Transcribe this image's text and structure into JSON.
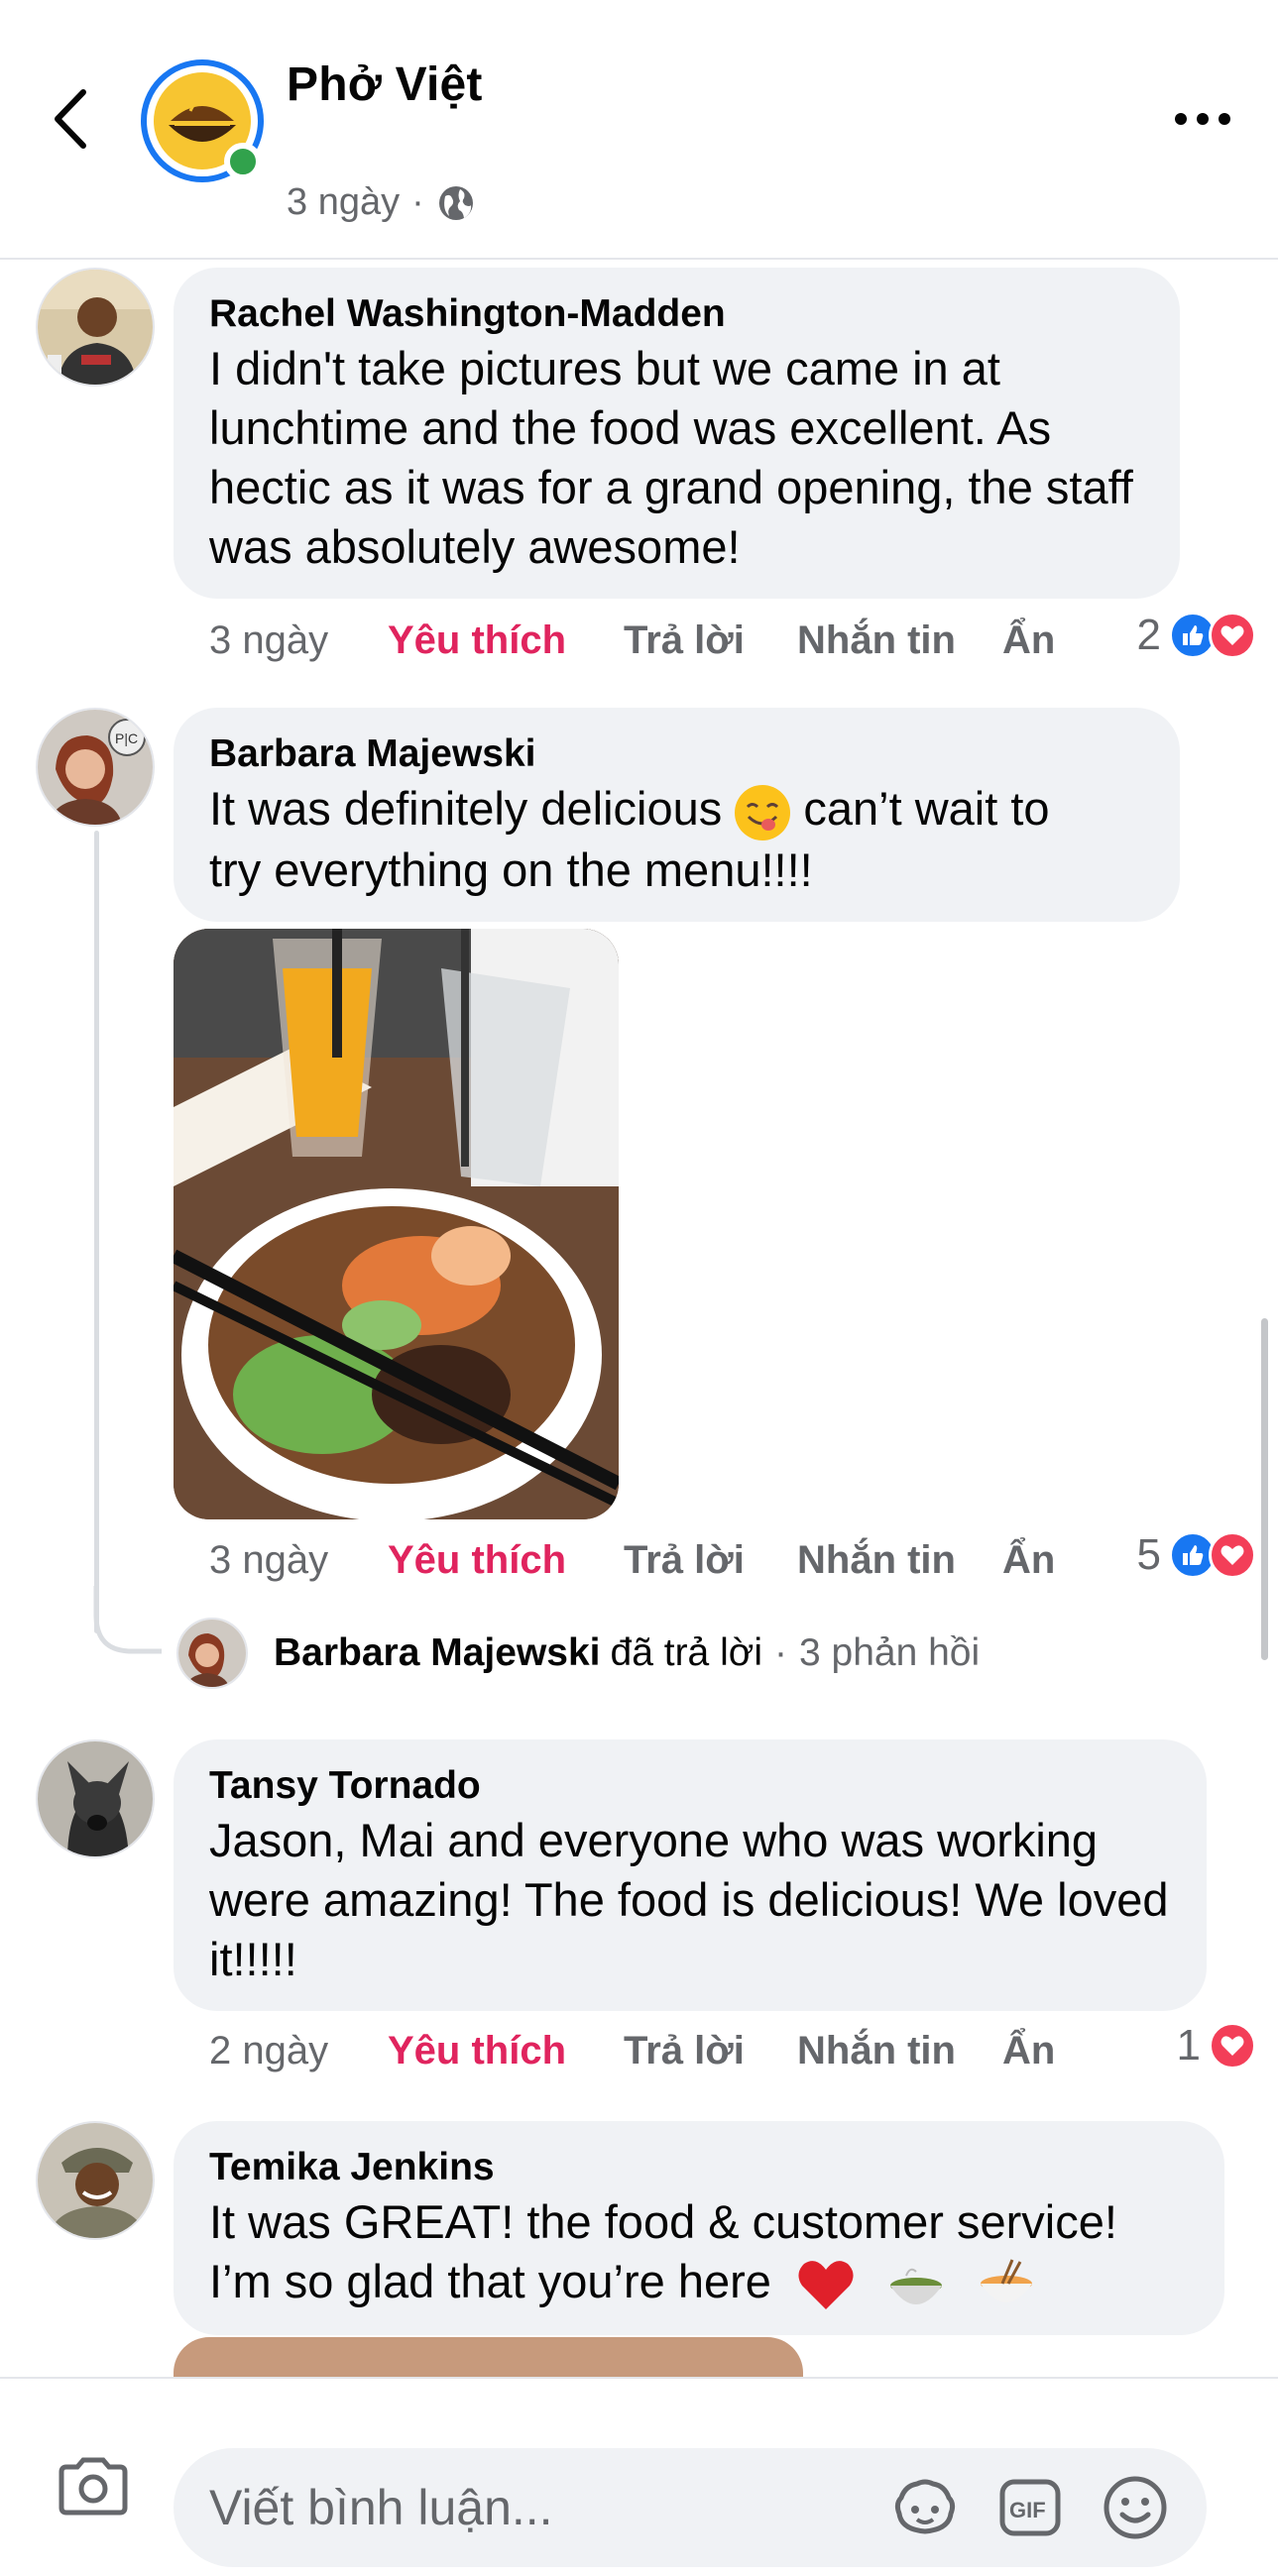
{
  "header": {
    "page_name": "Phở Việt",
    "time": "3 ngày",
    "separator": "·",
    "privacy_icon": "globe-icon"
  },
  "comments": [
    {
      "author": "Rachel Washington-Madden",
      "text": "I didn't take pictures but we came in at lunchtime and the food was excellent.  As hectic as it was for a grand opening, the staff was absolutely awesome!",
      "time": "3 ngày",
      "like": "Yêu thích",
      "reply": "Trả lời",
      "message": "Nhắn tin",
      "hide": "Ẩn",
      "reaction_count": "2",
      "reactions": [
        "like-icon",
        "love-icon"
      ]
    },
    {
      "author": "Barbara Majewski",
      "text_before_emoji": "It was definitely delicious ",
      "emoji": "yum-face-emoji",
      "text_after_emoji": " can’t wait to",
      "text_line2": "try everything on the menu!!!!",
      "time": "3 ngày",
      "like": "Yêu thích",
      "reply": "Trả lời",
      "message": "Nhắn tin",
      "hide": "Ẩn",
      "reaction_count": "5",
      "reactions": [
        "like-icon",
        "love-icon"
      ],
      "replies_summary": {
        "name": "Barbara Majewski",
        "action": "đã trả lời",
        "separator": "·",
        "count": "3 phản hồi"
      }
    },
    {
      "author": "Tansy Tornado",
      "text": "Jason, Mai and everyone who was working were amazing!  The food is delicious!  We loved it!!!!!",
      "time": "2 ngày",
      "like": "Yêu thích",
      "reply": "Trả lời",
      "message": "Nhắn tin",
      "hide": "Ẩn",
      "reaction_count": "1",
      "reactions": [
        "love-icon"
      ]
    },
    {
      "author": "Temika Jenkins",
      "text_line1": "It was GREAT! the food & customer service!",
      "text_line2": "I’m so glad that you’re here",
      "emojis": [
        "red-heart-emoji",
        "pho-bowl-emoji",
        "ramen-bowl-emoji"
      ]
    }
  ],
  "composer": {
    "placeholder": "Viết bình luận...",
    "icons": [
      "camera-icon",
      "avatar-sticker-icon",
      "gif-icon",
      "emoji-icon"
    ]
  },
  "colors": {
    "like_text": "#e0245e",
    "accent": "#1877f2",
    "love": "#f33e58",
    "bubble": "#f0f2f5",
    "secondary_text": "#65676b"
  }
}
